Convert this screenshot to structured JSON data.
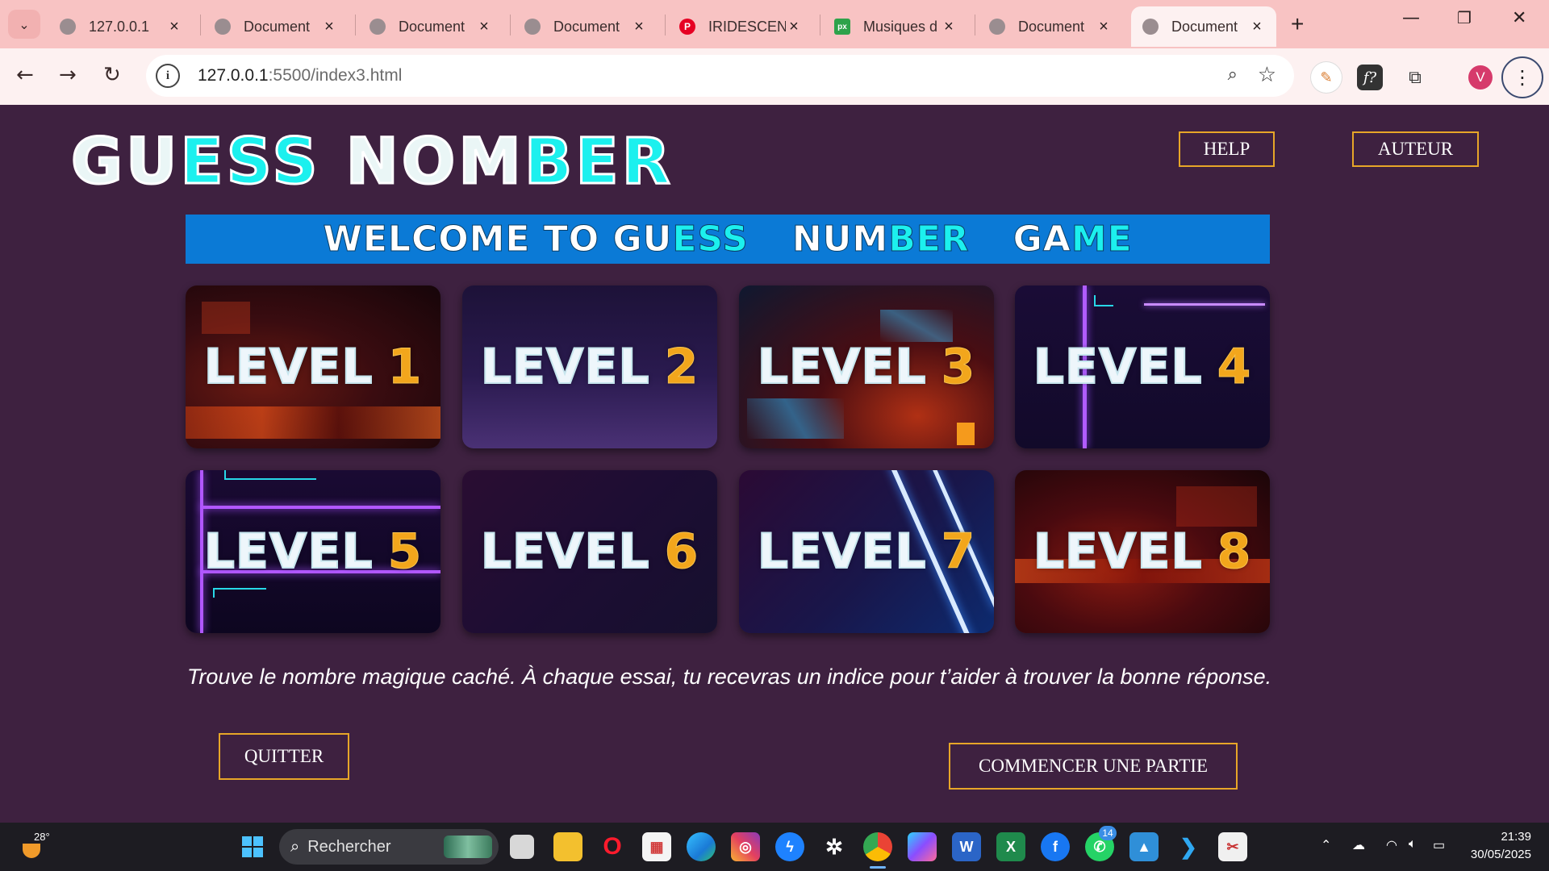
{
  "browser": {
    "tabs": [
      {
        "title": "127.0.0.1",
        "favicon": "globe-icon"
      },
      {
        "title": "Document",
        "favicon": "globe-icon"
      },
      {
        "title": "Document",
        "favicon": "globe-icon"
      },
      {
        "title": "Document",
        "favicon": "globe-icon"
      },
      {
        "title": "IRIDESCENT",
        "favicon": "pinterest-icon"
      },
      {
        "title": "Musiques d",
        "favicon": "pixabay-icon"
      },
      {
        "title": "Document",
        "favicon": "globe-icon"
      },
      {
        "title": "Document",
        "favicon": "globe-icon"
      }
    ],
    "active_tab": 7,
    "address": {
      "host": "127.0.0.1",
      "path": ":5500/index3.html"
    },
    "profile_initial": "V"
  },
  "page": {
    "logo": {
      "part1": "GU",
      "part2": "ESS",
      "part3": "NOM",
      "part4": "BER"
    },
    "header_buttons": {
      "help": "HELP",
      "author": "AUTEUR"
    },
    "banner": {
      "w1": "WELCOME TO GU",
      "w2": "ESS",
      "w3": "NUM",
      "w4": "BER",
      "w5": "GA",
      "w6": "ME"
    },
    "levels": [
      {
        "label": "LEVEL",
        "num": "1"
      },
      {
        "label": "LEVEL",
        "num": "2"
      },
      {
        "label": "LEVEL",
        "num": "3"
      },
      {
        "label": "LEVEL",
        "num": "4"
      },
      {
        "label": "LEVEL",
        "num": "5"
      },
      {
        "label": "LEVEL",
        "num": "6"
      },
      {
        "label": "LEVEL",
        "num": "7"
      },
      {
        "label": "LEVEL",
        "num": "8"
      }
    ],
    "tagline": "Trouve le nombre magique caché. À chaque essai, tu recevras un indice pour t’aider à trouver la bonne réponse.",
    "actions": {
      "quit": "QUITTER",
      "start": "COMMENCER UNE PARTIE"
    },
    "colors": {
      "background": "#3e2140",
      "accent_border": "#e7a628",
      "cyan": "#1cf0ee",
      "banner": "#0b7ad6",
      "level_number": "#f2a61c"
    }
  },
  "taskbar": {
    "weather_temp": "28°",
    "search_placeholder": "Rechercher",
    "whatsapp_badge": "14",
    "time": "21:39",
    "date": "30/05/2025"
  }
}
